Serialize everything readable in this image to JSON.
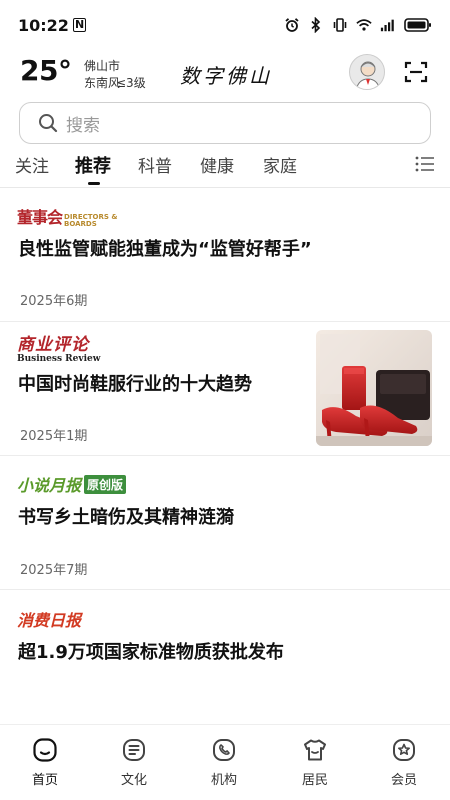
{
  "status_bar": {
    "time": "10:22",
    "n_badge": "N"
  },
  "header": {
    "temperature": "25°",
    "city": "佛山市",
    "wind": "东南风",
    "wind_level": "≤3级",
    "app_title": "数字佛山"
  },
  "search": {
    "placeholder": "搜索"
  },
  "tabs": [
    {
      "label": "关注",
      "active": false
    },
    {
      "label": "推荐",
      "active": true
    },
    {
      "label": "科普",
      "active": false
    },
    {
      "label": "健康",
      "active": false
    },
    {
      "label": "家庭",
      "active": false
    }
  ],
  "articles": [
    {
      "publication": "董事会",
      "publication_en": "DIRECTORS & BOARDS",
      "title": "良性监管赋能独董成为“监管好帮手”",
      "date": "2025年6期"
    },
    {
      "publication": "商业评论",
      "publication_en": "Business Review",
      "title": "中国时尚鞋服行业的十大趋势",
      "date": "2025年1期"
    },
    {
      "publication": "小说月报",
      "publication_tag": "原创版",
      "title": "书写乡土暗伤及其精神涟漪",
      "date": "2025年7期"
    },
    {
      "publication": "消费日报",
      "title": "超1.9万项国家标准物质获批发布"
    }
  ],
  "bottom_nav": [
    {
      "label": "首页",
      "icon": "home-icon",
      "active": true
    },
    {
      "label": "文化",
      "icon": "culture-icon",
      "active": false
    },
    {
      "label": "机构",
      "icon": "institution-icon",
      "active": false
    },
    {
      "label": "居民",
      "icon": "resident-icon",
      "active": false
    },
    {
      "label": "会员",
      "icon": "member-icon",
      "active": false
    }
  ],
  "colors": {
    "accent": "#111111",
    "brand_red": "#b3252b",
    "brand_green": "#3d8f3d",
    "consumer_red": "#d23a22"
  }
}
